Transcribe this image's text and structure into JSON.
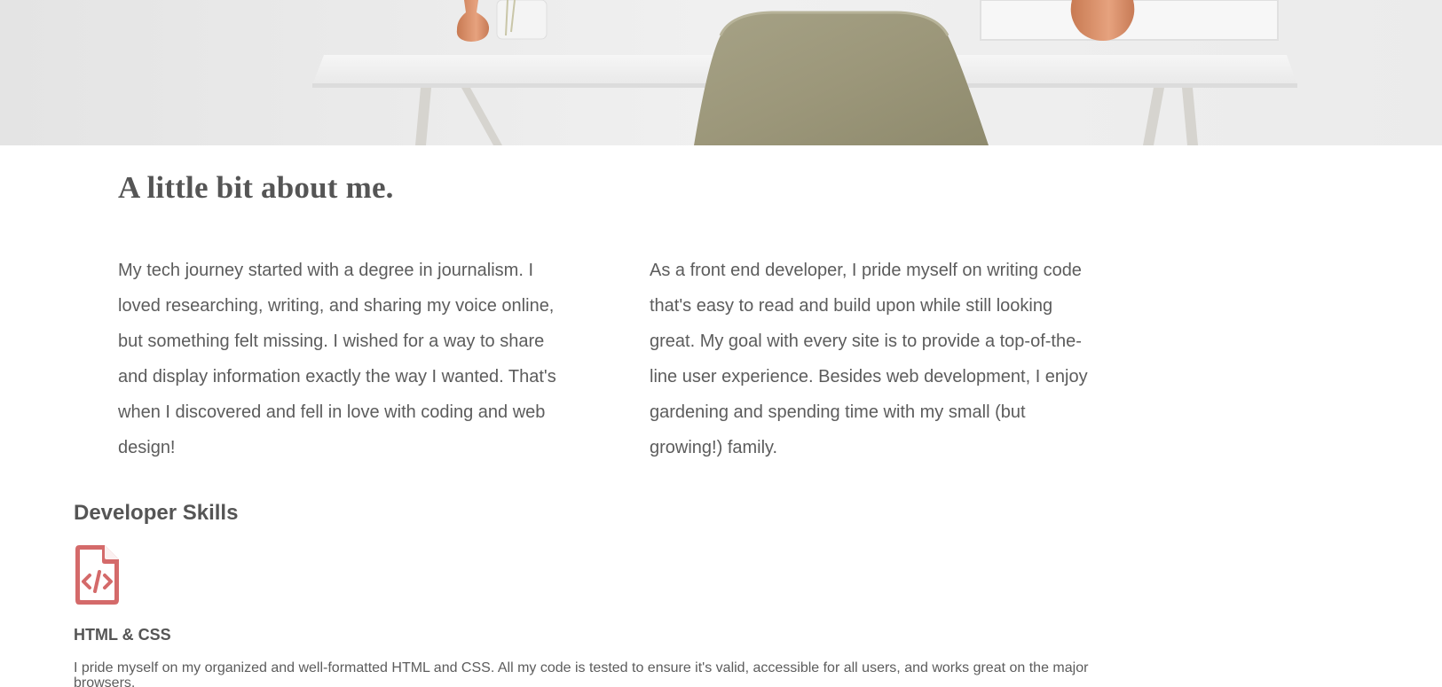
{
  "hero": {
    "image": "office-desk-chair-photo"
  },
  "about": {
    "heading": "A little bit about me.",
    "paragraph_left": "My tech journey started with a degree in journalism. I loved researching, writing, and sharing my voice online, but something felt missing. I wished for a way to share and display information exactly the way I wanted. That's when I discovered and fell in love with coding and web design!",
    "paragraph_right": "As a front end developer, I pride myself on writing code that's easy to read and build upon while still looking great. My goal with every site is to provide a top-of-the-line user experience. Besides web development, I enjoy gardening and spending time with my small (but growing!) family."
  },
  "skills": {
    "heading": "Developer Skills",
    "items": [
      {
        "icon": "file-code-icon",
        "title": "HTML & CSS",
        "description": "I pride myself on my organized and well-formatted HTML and CSS. All my code is tested to ensure it's valid, accessible for all users, and works great on the major browsers."
      }
    ]
  },
  "colors": {
    "text": "#5c5c5c",
    "heading": "#555555",
    "icon_accent": "#d46a6a",
    "background": "#ffffff"
  }
}
